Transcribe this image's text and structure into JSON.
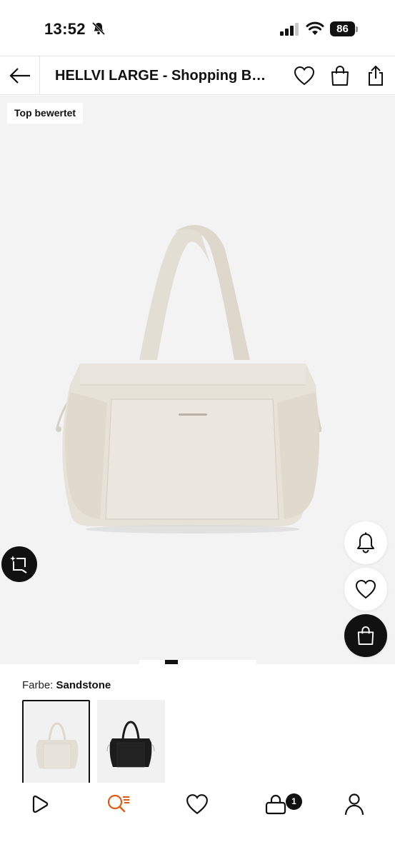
{
  "status_bar": {
    "time": "13:52",
    "battery": "86",
    "icons": [
      "bell-off-icon",
      "signal-icon",
      "wifi-icon",
      "battery-icon"
    ]
  },
  "nav": {
    "title": "HELLVI LARGE - Shopping Bag - sandstone",
    "icons": [
      "back-arrow-icon",
      "heart-icon",
      "shopping-bag-icon",
      "share-icon"
    ]
  },
  "product": {
    "badge": "Top bewertet",
    "image_icon": "tote-bag-image",
    "floating_actions": [
      "bell-icon",
      "heart-icon",
      "shopping-bag-icon"
    ],
    "lens_icon": "visual-search-icon"
  },
  "color": {
    "label": "Farbe:",
    "selected": "Sandstone",
    "swatches": [
      {
        "name": "Sandstone",
        "hex": "#e6e1d7",
        "selected": true
      },
      {
        "name": "Black",
        "hex": "#1a1a1a",
        "selected": false
      }
    ]
  },
  "tabbar": {
    "items": [
      "home-icon",
      "search-icon",
      "wishlist-icon",
      "cart-icon",
      "account-icon"
    ],
    "cart_count": "1"
  },
  "colors": {
    "accent": "#e05a14",
    "text": "#111111",
    "hero_bg": "#f3f3f3",
    "bag": "#e6e1d7"
  }
}
